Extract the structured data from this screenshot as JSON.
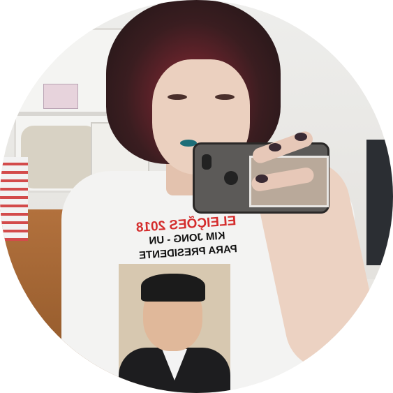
{
  "image": {
    "shape": "circle-avatar",
    "background_color": "#ffffff"
  },
  "shirt_print": {
    "line1": "ELEIÇÕES 2018",
    "line2": "KIM JONG - UN",
    "line3": "PARA PRESIDENTE",
    "line1_color": "#d42c2c",
    "text_color": "#111111"
  }
}
